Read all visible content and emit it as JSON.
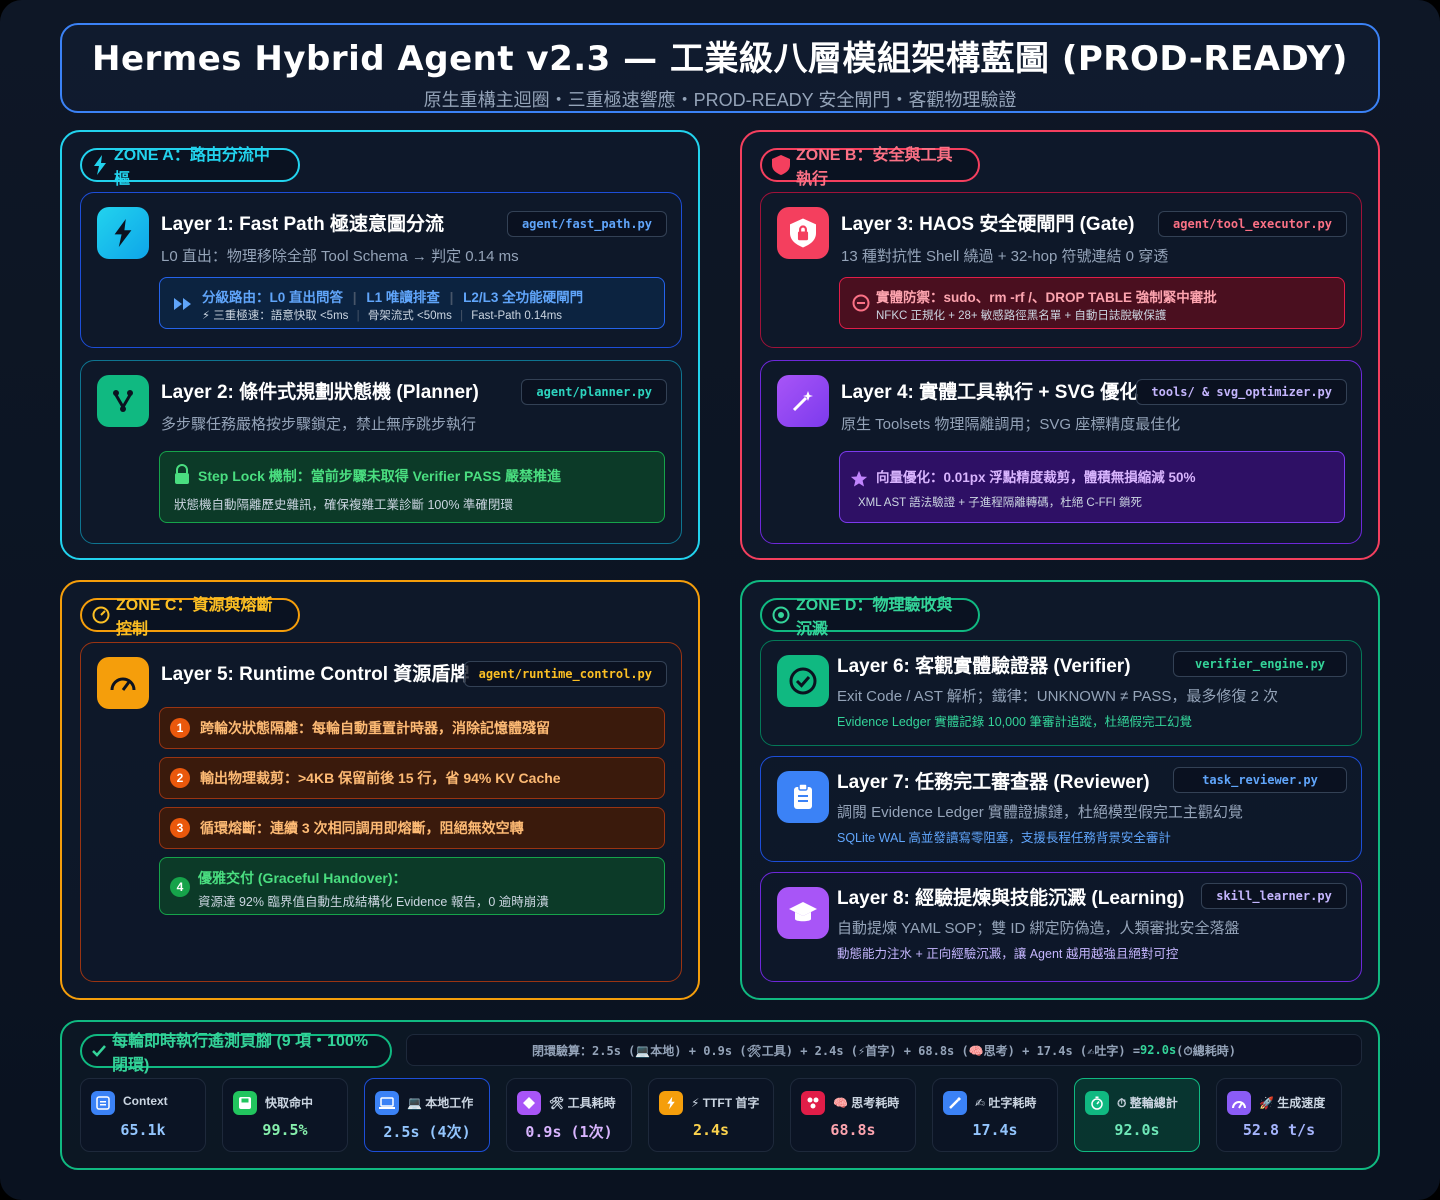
{
  "header": {
    "title": "Hermes Hybrid Agent v2.3 — 工業級八層模組架構藍圖 (PROD-READY)",
    "subtitle": "原生重構主迴圈・三重極速響應・PROD-READY 安全閘門・客觀物理驗證"
  },
  "zones": {
    "a": {
      "label": "ZONE A：路由分流中樞",
      "color": "#22d3ee",
      "layer1": {
        "title": "Layer 1: Fast Path 極速意圖分流",
        "file": "agent/fast_path.py",
        "desc": "L0 直出：物理移除全部 Tool Schema → 判定 0.14 ms",
        "note_line1_a": "分級路由：L0 直出問答",
        "note_line1_b": "L1 唯讀排查",
        "note_line1_c": "L2/L3 全功能硬閘門",
        "note_line2_a": "⚡ 三重極速：語意快取 <5ms",
        "note_line2_b": "骨架流式 <50ms",
        "note_line2_c": "Fast-Path 0.14ms"
      },
      "layer2": {
        "title": "Layer 2: 條件式規劃狀態機 (Planner)",
        "file": "agent/planner.py",
        "desc": "多步驟任務嚴格按步驟鎖定，禁止無序跳步執行",
        "note_line1": "Step Lock 機制：當前步驟未取得 Verifier PASS 嚴禁推進",
        "note_line2": "狀態機自動隔離歷史雜訊，確保複雜工業診斷 100% 準確閉環"
      }
    },
    "b": {
      "label": "ZONE B：安全與工具執行",
      "color": "#f43f5e",
      "layer3": {
        "title": "Layer 3: HAOS 安全硬閘門 (Gate)",
        "file": "agent/tool_executor.py",
        "desc": "13 種對抗性 Shell 繞過 + 32-hop 符號連結 0 穿透",
        "note_line1": "實體防禦：sudo、rm -rf /、DROP TABLE 強制緊中審批",
        "note_line2": "NFKC 正規化 + 28+ 敏感路徑黑名單 + 自動日誌脫敏保護"
      },
      "layer4": {
        "title": "Layer 4: 實體工具執行 + SVG 優化",
        "file": "tools/ & svg_optimizer.py",
        "desc": "原生 Toolsets 物理隔離調用；SVG 座標精度最佳化",
        "note_line1": "向量優化：0.01px 浮點精度裁剪，體積無損縮減 50%",
        "note_line2": "XML AST 語法驗證 + 子進程隔離轉碼，杜絕 C-FFI 鎖死"
      }
    },
    "c": {
      "label": "ZONE C：資源與熔斷控制",
      "color": "#f59e0b",
      "layer5": {
        "title": "Layer 5: Runtime Control 資源盾牌",
        "file": "agent/runtime_control.py",
        "steps": [
          {
            "num": "1",
            "text": "跨輪次狀態隔離：每輪自動重置計時器，消除記憶體殘留"
          },
          {
            "num": "2",
            "text": "輸出物理裁剪：>4KB 保留前後 15 行，省 94% KV Cache"
          },
          {
            "num": "3",
            "text": "循環熔斷：連續 3 次相同調用即熔斷，阻絕無效空轉"
          }
        ],
        "handover_num": "4",
        "handover_title": "優雅交付 (Graceful Handover)：",
        "handover_text": "資源達 92% 臨界值自動生成結構化 Evidence 報告，0 逾時崩潰"
      }
    },
    "d": {
      "label": "ZONE D：物理驗收與沉澱",
      "color": "#10b981",
      "layer6": {
        "title": "Layer 6: 客觀實體驗證器 (Verifier)",
        "file": "verifier_engine.py",
        "desc": "Exit Code / AST 解析；鐵律：UNKNOWN ≠ PASS，最多修復 2 次",
        "desc2": "Evidence Ledger 實體記錄 10,000 筆審計追蹤，杜絕假完工幻覺"
      },
      "layer7": {
        "title": "Layer 7: 任務完工審查器 (Reviewer)",
        "file": "task_reviewer.py",
        "desc": "調閱 Evidence Ledger 實體證據鏈，杜絕模型假完工主觀幻覺",
        "desc2": "SQLite WAL 高並發讀寫零阻塞，支援長程任務背景安全審計"
      },
      "layer8": {
        "title": "Layer 8: 經驗提煉與技能沉澱 (Learning)",
        "file": "skill_learner.py",
        "desc": "自動提煉 YAML SOP；雙 ID 綁定防偽造，人類審批安全落盤",
        "desc2": "動態能力注水 + 正向經驗沉澱，讓 Agent 越用越強且絕對可控"
      }
    }
  },
  "telemetry": {
    "label": "每輪即時執行遙測頁腳 (9 項・100% 閉環)",
    "formula_prefix": "閉環驗算：2.5s (💻本地) + 0.9s (🛠工具) + 2.4s (⚡首字) + 68.8s (🧠思考) + 17.4s (✍吐字) = ",
    "formula_total": "92.0s",
    "formula_suffix": " (⏱總耗時)",
    "metrics": [
      {
        "label": "Context",
        "value": "65.1k",
        "icon": "context-icon",
        "color": "#3b82f6",
        "val_color": "#93c5fd"
      },
      {
        "label": "快取命中",
        "value": "99.5%",
        "icon": "cache-icon",
        "color": "#22c55e",
        "val_color": "#86efac"
      },
      {
        "label": "💻 本地工作",
        "value": "2.5s (4次)",
        "icon": "laptop-icon",
        "color": "#3b82f6",
        "val_color": "#93c5fd"
      },
      {
        "label": "🛠 工具耗時",
        "value": "0.9s (1次)",
        "icon": "diamond-icon",
        "color": "#a855f7",
        "val_color": "#d8b4fe"
      },
      {
        "label": "⚡ TTFT 首字",
        "value": "2.4s",
        "icon": "bolt-icon",
        "color": "#f59e0b",
        "val_color": "#fcd34d"
      },
      {
        "label": "🧠 思考耗時",
        "value": "68.8s",
        "icon": "brain-icon",
        "color": "#e11d48",
        "val_color": "#fda4af"
      },
      {
        "label": "✍ 吐字耗時",
        "value": "17.4s",
        "icon": "pen-icon",
        "color": "#3b82f6",
        "val_color": "#93c5fd"
      },
      {
        "label": "⏱ 整輪總計",
        "value": "92.0s",
        "icon": "timer-icon",
        "color": "#10b981",
        "val_color": "#6ee7b7"
      },
      {
        "label": "🚀 生成速度",
        "value": "52.8 t/s",
        "icon": "speed-icon",
        "color": "#8b5cf6",
        "val_color": "#a5b4fc"
      }
    ]
  }
}
